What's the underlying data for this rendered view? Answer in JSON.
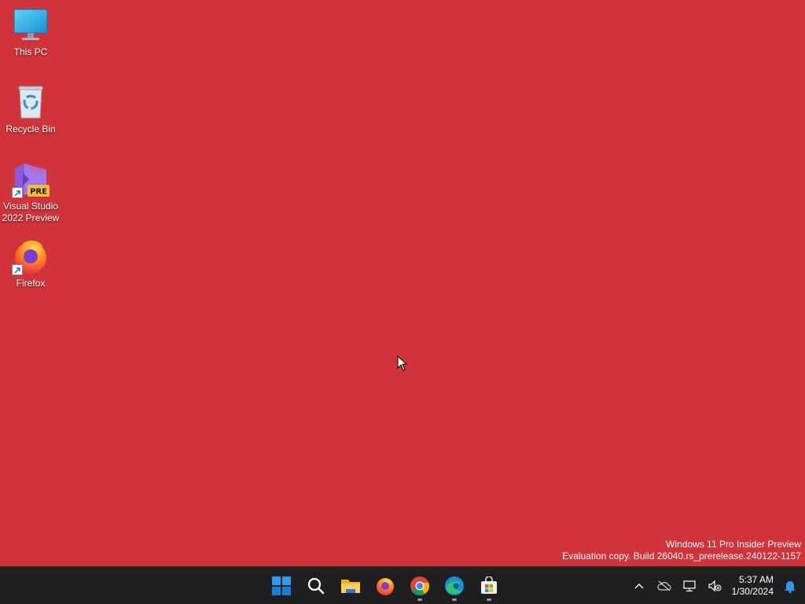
{
  "desktop": {
    "background": "#d0333a",
    "icons": [
      {
        "label": "This PC",
        "icon": "monitor-icon"
      },
      {
        "label": "Recycle Bin",
        "icon": "recycle-bin-icon"
      },
      {
        "label": "Visual Studio\n2022 Preview",
        "icon": "visual-studio-preview-icon",
        "badge": "PRE"
      },
      {
        "label": "Firefox",
        "icon": "firefox-icon"
      }
    ]
  },
  "watermark": {
    "line1": "Windows 11 Pro Insider Preview",
    "line2": "Evaluation copy. Build 26040.rs_prerelease.240122-1157"
  },
  "taskbar": {
    "apps": [
      {
        "name": "Start",
        "icon": "windows-start-icon"
      },
      {
        "name": "Search",
        "icon": "search-icon"
      },
      {
        "name": "File Explorer",
        "icon": "folder-icon"
      },
      {
        "name": "Firefox",
        "icon": "firefox-icon"
      },
      {
        "name": "Google Chrome",
        "icon": "chrome-icon",
        "running": true
      },
      {
        "name": "Microsoft Edge",
        "icon": "edge-icon",
        "running": true
      },
      {
        "name": "Microsoft Store",
        "icon": "store-icon",
        "running": true
      }
    ],
    "tray": {
      "icons": [
        "chevron-up-icon",
        "onedrive-cloud-icon",
        "network-icon",
        "volume-muted-icon"
      ],
      "time": "5:37 AM",
      "date": "1/30/2024",
      "notification_icon": "bell-icon"
    }
  },
  "colors": {
    "taskbar": "#1f1f1f",
    "accent": "#0078d4"
  }
}
